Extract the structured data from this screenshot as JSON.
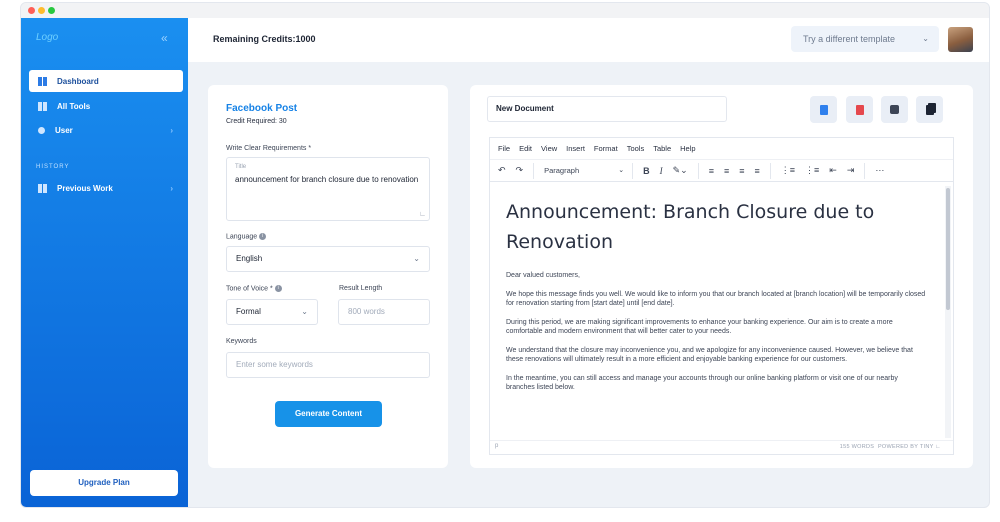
{
  "sidebar": {
    "logo": "Logo",
    "collapse_icon": "double-chevron-left-icon",
    "items": [
      {
        "label": "Dashboard",
        "icon": "dashboard-icon",
        "active": true
      },
      {
        "label": "All Tools",
        "icon": "grid-icon"
      },
      {
        "label": "User",
        "icon": "user-icon"
      }
    ],
    "history_label": "HISTORY",
    "history_items": [
      {
        "label": "Previous Work",
        "icon": "history-icon"
      }
    ],
    "upgrade_label": "Upgrade Plan"
  },
  "header": {
    "credits": "Remaining Credits:1000",
    "template_button": "Try a different template"
  },
  "form": {
    "title": "Facebook Post",
    "credit_required": "Credit Required: 30",
    "requirements_label": "Write Clear Requirements *",
    "requirements_caption": "Title",
    "requirements_value": "announcement for branch closure due to renovation",
    "language_label": "Language",
    "language_value": "English",
    "tone_label": "Tone of Voice *",
    "tone_value": "Formal",
    "length_label": "Result Length",
    "length_placeholder": "800 words",
    "keywords_label": "Keywords",
    "keywords_placeholder": "Enter some keywords",
    "generate_label": "Generate Content"
  },
  "editor": {
    "document_name": "New Document",
    "actions": [
      {
        "icon": "word-doc-icon",
        "color": "#2f80ed"
      },
      {
        "icon": "pdf-icon",
        "color": "#e5484d"
      },
      {
        "icon": "save-icon",
        "color": "#3d4556"
      },
      {
        "icon": "copy-icon",
        "color": "#1d2433"
      }
    ],
    "menu": [
      "File",
      "Edit",
      "View",
      "Insert",
      "Format",
      "Tools",
      "Table",
      "Help"
    ],
    "paragraph_format": "Paragraph",
    "heading": "Announcement: Branch Closure due to Renovation",
    "paragraphs": [
      "Dear valued customers,",
      "We hope this message finds you well. We would like to inform you that our branch located at [branch location] will be temporarily closed for renovation starting from [start date] until [end date].",
      "During this period, we are making significant improvements to enhance your banking experience. Our aim is to create a more comfortable and modern environment that will better cater to your needs.",
      "We understand that the closure may inconvenience you, and we apologize for any inconvenience caused. However, we believe that these renovations will ultimately result in a more efficient and enjoyable banking experience for our customers.",
      "In the meantime, you can still access and manage your accounts through our online banking platform or visit one of our nearby branches listed below."
    ],
    "status_path": "p",
    "word_count": "155 WORDS",
    "powered_by": "POWERED BY TINY"
  },
  "colors": {
    "sidebar": "#0a63d6",
    "accent": "#1792e8",
    "title": "#1682e6"
  }
}
